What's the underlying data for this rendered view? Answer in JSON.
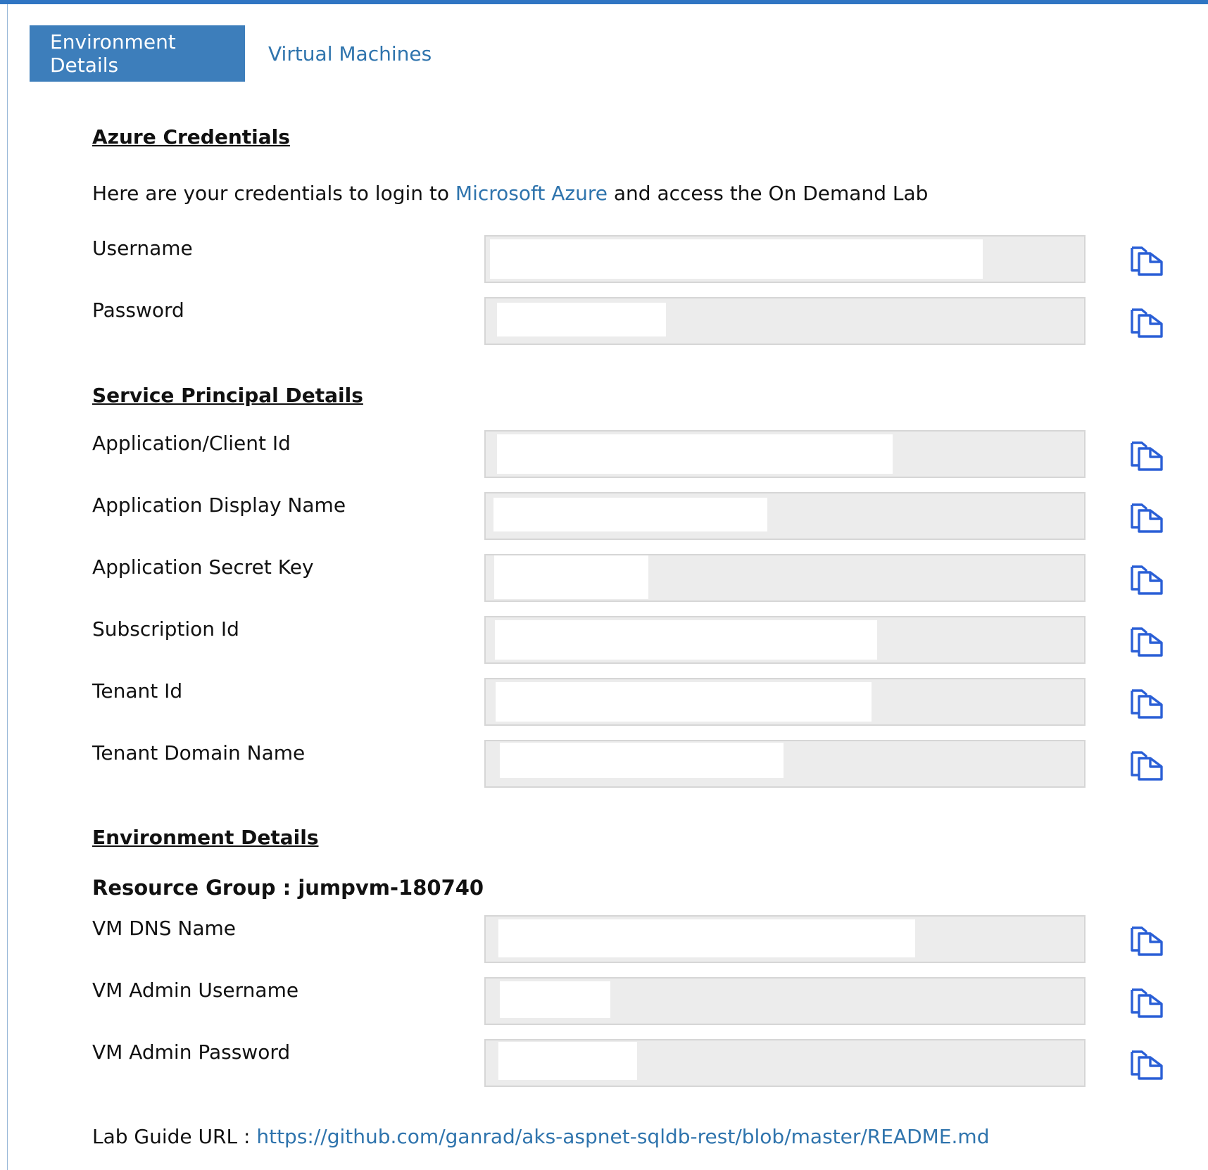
{
  "tabs": [
    {
      "label": "Environment Details",
      "active": true
    },
    {
      "label": "Virtual Machines",
      "active": false
    }
  ],
  "azure": {
    "title": "Azure Credentials",
    "intro_prefix": "Here are your credentials to login to ",
    "intro_link": "Microsoft Azure",
    "intro_suffix": " and access the On Demand Lab",
    "fields": [
      {
        "label": "Username"
      },
      {
        "label": "Password"
      }
    ]
  },
  "service_principal": {
    "title": "Service Principal Details",
    "fields": [
      {
        "label": "Application/Client Id"
      },
      {
        "label": "Application Display Name"
      },
      {
        "label": "Application Secret Key"
      },
      {
        "label": "Subscription Id"
      },
      {
        "label": "Tenant Id"
      },
      {
        "label": "Tenant Domain Name"
      }
    ]
  },
  "environment": {
    "title": "Environment Details",
    "resource_group_label": "Resource Group : ",
    "resource_group_value": "jumpvm-180740",
    "fields": [
      {
        "label": "VM DNS Name"
      },
      {
        "label": "VM Admin Username"
      },
      {
        "label": "VM Admin Password"
      }
    ]
  },
  "lab_guide": {
    "label": "Lab Guide URL : ",
    "url": "https://github.com/ganrad/aks-aspnet-sqldb-rest/blob/master/README.md"
  },
  "icons": {
    "copy": "copy-icon"
  },
  "colors": {
    "accent": "#2f75c3",
    "tab_active_bg": "#3d7ebb",
    "link": "#2f74ad",
    "field_bg": "#ececec",
    "copy_icon": "#2a5fd6"
  }
}
